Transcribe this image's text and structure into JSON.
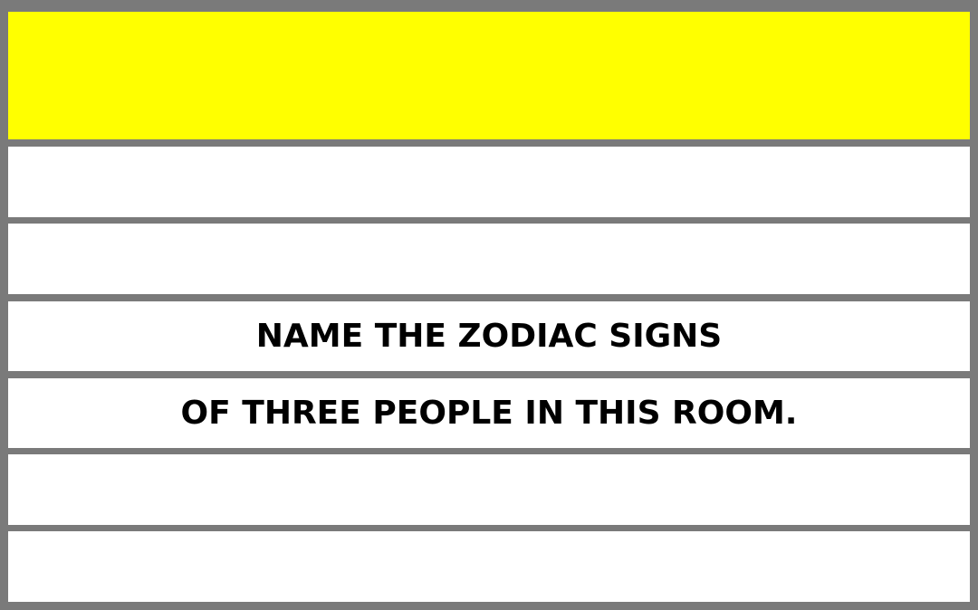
{
  "colors": {
    "border": "#7a7a7a",
    "header_band": "#ffff00",
    "row_background": "#ffffff",
    "text": "#000000"
  },
  "card": {
    "lines": [
      "",
      "",
      "NAME THE ZODIAC SIGNS",
      "OF THREE PEOPLE IN THIS ROOM.",
      "",
      ""
    ]
  }
}
